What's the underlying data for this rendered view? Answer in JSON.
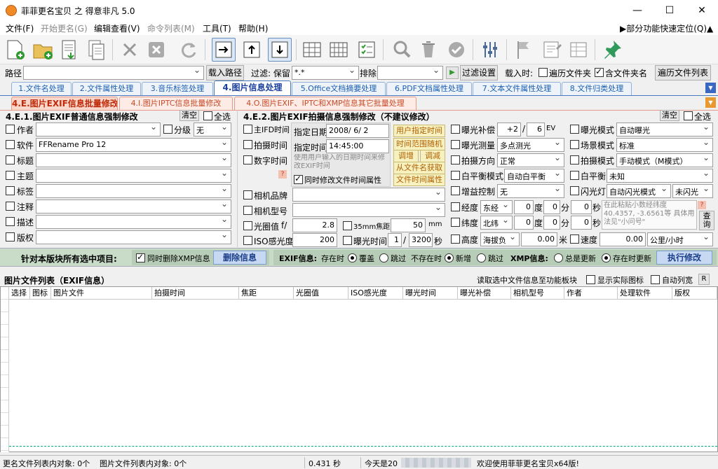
{
  "window": {
    "title": "菲菲更名宝贝 之 得意非凡 5.0",
    "min": "—",
    "max": "☐",
    "close": "✕"
  },
  "menu": [
    "文件(F)",
    "开始更名(G)",
    "编辑查看(V)",
    "命令列表(M)",
    "工具(T)",
    "帮助(H)"
  ],
  "menu_right": "▶部分功能快速定位(Q)▲",
  "pathbar": {
    "path_label": "路径",
    "path_value": "",
    "load_button": "载入路径",
    "filter_label": "过滤: 保留",
    "filter_value": "*.*",
    "exclude_label": "排除",
    "exclude_value": "",
    "filter_settings": "过滤设置",
    "load_when": "载入时:",
    "traverse_label": "遍历文件夹",
    "include_folder_label": "含文件夹名",
    "traverse_list_button": "遍历文件列表"
  },
  "tabs": [
    "1.文件名处理",
    "2.文件属性处理",
    "3.音乐标签处理",
    "4.图片信息处理",
    "5.Office文档摘要处理",
    "6.PDF文档属性处理",
    "7.文本文件属性处理",
    "8.文件归类处理"
  ],
  "subtabs": [
    "4.E.图片EXIF信息批量修改",
    "4.I.图片IPTC信息批量修改",
    "4.O.图片EXIF、IPTC和XMP信息其它批量处理"
  ],
  "left": {
    "header": "4.E.1.图片EXIF普通信息强制修改",
    "clear": "清空",
    "select_all": "全选",
    "fields": [
      {
        "label": "作者",
        "value": ""
      },
      {
        "label": "软件",
        "value": "FFRename Pro 12"
      },
      {
        "label": "标题",
        "value": ""
      },
      {
        "label": "主题",
        "value": ""
      },
      {
        "label": "标签",
        "value": ""
      },
      {
        "label": "注释",
        "value": ""
      },
      {
        "label": "描述",
        "value": ""
      },
      {
        "label": "版权",
        "value": ""
      }
    ],
    "rating_label": "分级",
    "rating_value": "无"
  },
  "right": {
    "header": "4.E.2.图片EXIF拍摄信息强制修改（不建议修改）",
    "clear": "清空",
    "select_all": "全选",
    "main_time": "主IFD时间",
    "shot_time": "拍摄时间",
    "digital_time": "数字时间",
    "date_label": "指定日期",
    "date_value": "2008/ 6/ 2",
    "time_label": "指定时间",
    "time_value": "14:45:00",
    "hint_text": "使用用户输入的日期时间来修改EXIF时间",
    "sync_label": "同时修改文件时间属性",
    "yellow_buttons": [
      "用户指定时间",
      "时间范围随机",
      "调增",
      "调减",
      "从文件名获取",
      "文件时间属性"
    ],
    "camera_brand": "相机品牌",
    "camera_model": "相机型号",
    "aperture_label": "光圈值",
    "aperture_unit": "f/",
    "aperture_value": "2.8",
    "focal_label": "35mm焦距",
    "focal_value": "50",
    "focal_unit": "mm",
    "iso_label": "ISO感光度",
    "iso_value": "200",
    "exposure_time_label": "曝光时间",
    "exposure_num": "1",
    "exposure_den": "3200",
    "exposure_unit": "秒",
    "ev_label": "曝光补偿",
    "ev_num": "+2",
    "ev_den": "6",
    "ev_unit": "EV",
    "metering_label": "曝光测量",
    "metering_value": "多点测光",
    "orientation_label": "拍摄方向",
    "orientation_value": "正常",
    "wb_mode_label": "白平衡模式",
    "wb_mode_value": "自动白平衡",
    "gain_label": "增益控制",
    "gain_value": "无",
    "exp_mode_label": "曝光模式",
    "exp_mode_value": "自动曝光",
    "scene_label": "场景模式",
    "scene_value": "标准",
    "shoot_mode_label": "拍摄模式",
    "shoot_mode_value": "手动模式（M模式）",
    "wb_label": "白平衡",
    "wb_value": "未知",
    "flash_label": "闪光灯",
    "flash_value": "自动闪光模式",
    "flash_value2": "未闪光",
    "lon_label": "经度",
    "lon_dir": "东经",
    "lat_label": "纬度",
    "lat_dir": "北纬",
    "deg": "度",
    "min": "分",
    "sec": "秒",
    "lon_d": "0",
    "lon_m": "0",
    "lon_s": "0",
    "lat_d": "0",
    "lat_m": "0",
    "lat_s": "0",
    "gps_hint": "在此粘贴小数经纬度 40.4357, -3.6561等 具体用法见\"小问号\"",
    "lookup": "查询",
    "alt_label": "高度",
    "alt_ref": "海拔负",
    "alt_value": "0.00",
    "alt_unit": "米",
    "speed_label": "速度",
    "speed_value": "0.00",
    "speed_unit": "公里/小时"
  },
  "actionbar": {
    "label": "针对本版块所有选中项目:",
    "del_xmp_label": "同时删除XMP信息",
    "del_info": "删除信息",
    "exif_label": "EXIF信息:",
    "exist_label": "存在时",
    "cover": "覆盖",
    "skip": "跳过",
    "notexist_label": "不存在时",
    "add": "新增",
    "skip2": "跳过",
    "xmp_label": "XMP信息:",
    "always": "总是更新",
    "when_exist": "存在时更新",
    "execute": "执行修改"
  },
  "list": {
    "title": "图片文件列表（EXIF信息）",
    "read_selected": "读取选中文件信息至功能板块",
    "show_icon": "显示实际图标",
    "auto_width": "自动列宽",
    "r": "R",
    "columns": [
      "选择",
      "图标",
      "图片文件",
      "拍摄时间",
      "焦距",
      "光圈值",
      "ISO感光度",
      "曝光时间",
      "曝光补偿",
      "相机型号",
      "作者",
      "处理软件",
      "版权"
    ]
  },
  "status": {
    "s1": "更名文件列表内对象: 0个",
    "s2": "图片文件列表内对象: 0个",
    "s3": "0.431 秒",
    "s4": "今天是20",
    "s5": "欢迎使用菲菲更名宝贝x64版!"
  }
}
